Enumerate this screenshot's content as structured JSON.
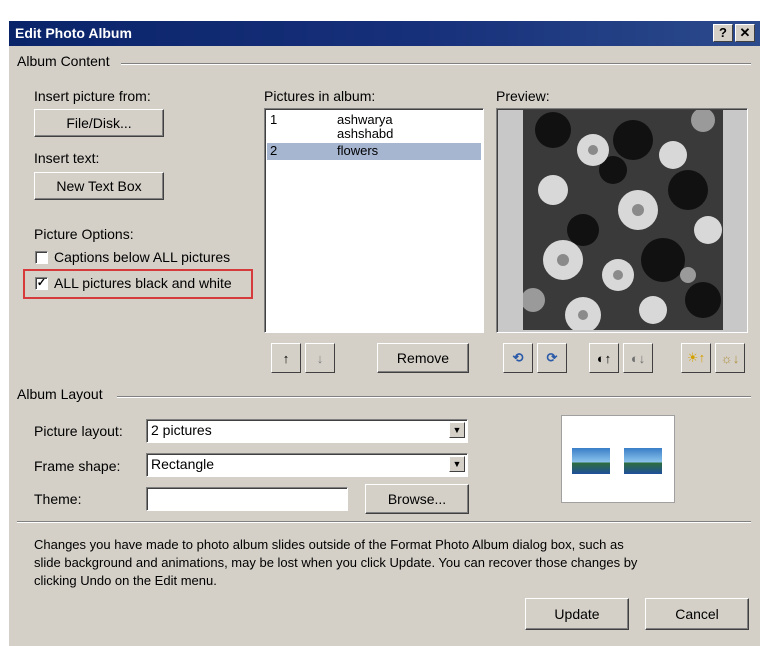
{
  "window": {
    "title": "Edit Photo Album"
  },
  "album_content": {
    "group_label": "Album Content",
    "insert_picture_label": "Insert picture from:",
    "file_disk_button": "File/Disk...",
    "insert_text_label": "Insert text:",
    "new_text_box_button": "New Text Box",
    "picture_options_label": "Picture Options:",
    "captions_option": {
      "label": "Captions below ALL pictures",
      "checked": false
    },
    "black_white_option": {
      "label": "ALL pictures black and white",
      "checked": true
    }
  },
  "pictures_list": {
    "label": "Pictures in album:",
    "items": [
      {
        "num": "1",
        "name": "ashwarya"
      },
      {
        "num": "",
        "name": "ashshabd"
      },
      {
        "num": "2",
        "name": "flowers",
        "selected": true
      }
    ],
    "remove_button": "Remove"
  },
  "preview": {
    "label": "Preview:"
  },
  "album_layout": {
    "group_label": "Album Layout",
    "picture_layout_label": "Picture layout:",
    "picture_layout_value": "2 pictures",
    "frame_shape_label": "Frame shape:",
    "frame_shape_value": "Rectangle",
    "theme_label": "Theme:",
    "theme_value": "",
    "browse_button": "Browse..."
  },
  "notice": {
    "line1": "Changes you have made to photo album slides outside of the Format Photo Album dialog box, such as",
    "line2": "slide background and animations, may be lost when you click Update. You can recover those changes by",
    "line3": "clicking Undo on the Edit menu."
  },
  "footer": {
    "update_button": "Update",
    "cancel_button": "Cancel"
  },
  "icons": {
    "help": "?",
    "close": "✕",
    "move_up": "↑",
    "move_down": "↓",
    "checkmark": "✓",
    "dropdown": "▼"
  },
  "colors": {
    "title_bar": "#0a246a",
    "dialog_bg": "#d4d0c8",
    "highlight": "#d63a3a",
    "selection": "#a6b5d0"
  }
}
